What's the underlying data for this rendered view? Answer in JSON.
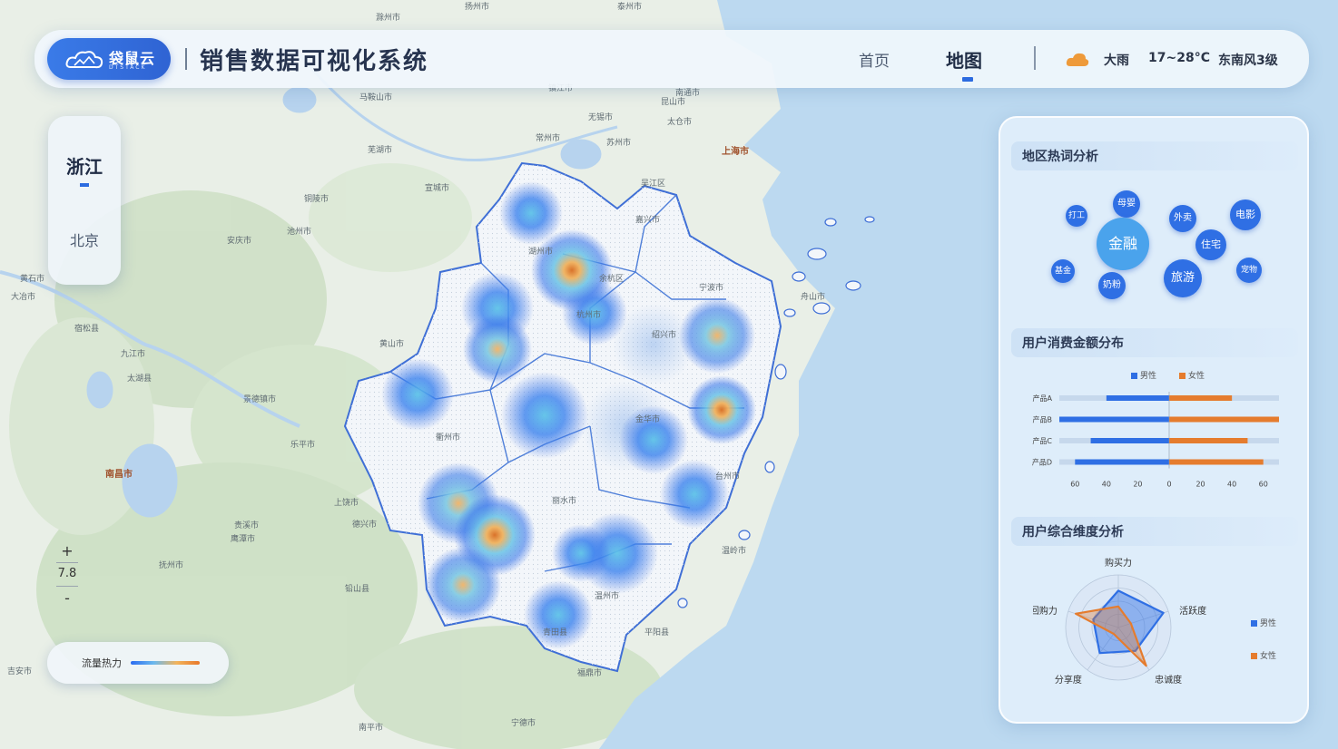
{
  "header": {
    "logo_name": "袋鼠云",
    "logo_sub": "DTSTACK",
    "app_title": "销售数据可视化系统",
    "nav": {
      "home": "首页",
      "map": "地图"
    },
    "weather": {
      "icon": "cloud-icon",
      "condition": "大雨",
      "temperature": "17~28°C",
      "wind": "东南风3级"
    }
  },
  "regions": {
    "zhejiang": "浙江",
    "beijing": "北京"
  },
  "zoom": {
    "in": "+",
    "level": "7.8",
    "out": "-"
  },
  "legend": {
    "label": "流量热力"
  },
  "map": {
    "cities": [
      "滁州市",
      "马鞍山市",
      "芜湖市",
      "铜陵市",
      "池州市",
      "安庆市",
      "黄山市",
      "景德镇市",
      "九江市",
      "南昌市",
      "上饶市",
      "抚州市",
      "鹰潭市",
      "宣城市",
      "常州市",
      "无锡市",
      "苏州市",
      "南通市",
      "上海市",
      "太仓市",
      "嘉兴市",
      "湖州市",
      "杭州市",
      "绍兴市",
      "宁波市",
      "舟山市",
      "金华市",
      "衢州市",
      "丽水市",
      "温州市",
      "台州市",
      "宁德市",
      "南平市",
      "黄石市",
      "吉安市",
      "扬州市",
      "镇江市",
      "泰州市",
      "乐平市",
      "德兴市",
      "贵溪市",
      "铅山县",
      "大冶市",
      "宿松县",
      "太湖县",
      "吴江区",
      "昆山市",
      "温岭市",
      "平阳县",
      "福鼎市",
      "青田县",
      "余杭区"
    ]
  },
  "panel": {
    "hotwords": {
      "title": "地区热词分析",
      "words": [
        "打工",
        "母婴",
        "金融",
        "外卖",
        "电影",
        "住宅",
        "基金",
        "奶粉",
        "旅游",
        "宠物"
      ]
    },
    "spending": {
      "title": "用户消费金额分布",
      "legend": [
        "男性",
        "女性"
      ],
      "colors": {
        "male": "#2f6fe4",
        "female": "#e57c2e"
      }
    },
    "dimension": {
      "title": "用户综合维度分析",
      "legend": [
        "男性",
        "女性"
      ]
    }
  },
  "chart_data": [
    {
      "type": "bar",
      "title": "用户消费金额分布",
      "orientation": "horizontal-diverging",
      "categories": [
        "产品A",
        "产品B",
        "产品C",
        "产品D"
      ],
      "series": [
        {
          "name": "男性",
          "values": [
            40,
            70,
            50,
            60
          ]
        },
        {
          "name": "女性",
          "values": [
            40,
            70,
            50,
            60
          ]
        }
      ],
      "xticks": [
        "60",
        "40",
        "20",
        "0",
        "20",
        "40",
        "60"
      ],
      "xlim": [
        -70,
        70
      ]
    },
    {
      "type": "radar",
      "title": "用户综合维度分析",
      "indicators": [
        "购买力",
        "活跃度",
        "忠诚度",
        "分享度",
        "回购力"
      ],
      "series": [
        {
          "name": "男性",
          "values": [
            70,
            90,
            55,
            60,
            50
          ]
        },
        {
          "name": "女性",
          "values": [
            40,
            25,
            90,
            15,
            85
          ]
        }
      ],
      "max": 100
    }
  ]
}
